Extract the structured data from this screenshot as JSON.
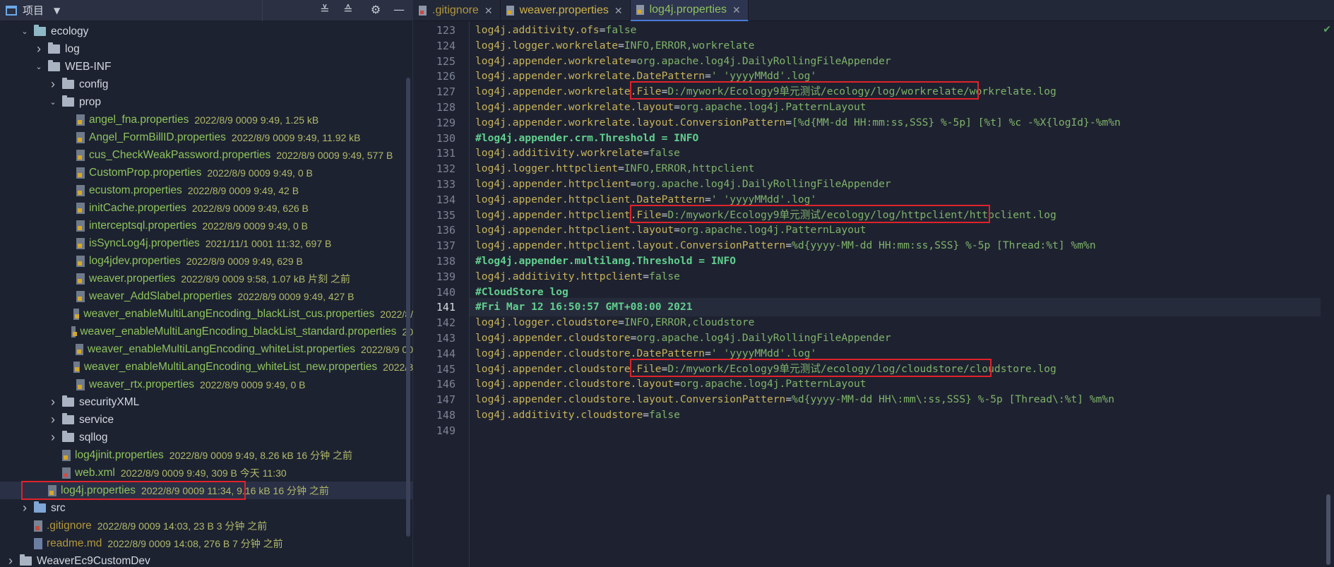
{
  "project_pane": {
    "title": "项目",
    "tree": [
      {
        "indent": 1,
        "arrow": "down",
        "icon": "folder-teal",
        "name": "ecology",
        "style": "normal",
        "meta": ""
      },
      {
        "indent": 2,
        "arrow": "right",
        "icon": "folder",
        "name": "log",
        "style": "normal",
        "meta": ""
      },
      {
        "indent": 2,
        "arrow": "down",
        "icon": "folder",
        "name": "WEB-INF",
        "style": "normal",
        "meta": ""
      },
      {
        "indent": 3,
        "arrow": "right",
        "icon": "folder",
        "name": "config",
        "style": "normal",
        "meta": ""
      },
      {
        "indent": 3,
        "arrow": "down",
        "icon": "folder",
        "name": "prop",
        "style": "normal",
        "meta": ""
      },
      {
        "indent": 4,
        "arrow": "",
        "icon": "properties",
        "name": "angel_fna.properties",
        "style": "mod",
        "meta": "2022/8/9 0009 9:49, 1.25 kB"
      },
      {
        "indent": 4,
        "arrow": "",
        "icon": "properties",
        "name": "Angel_FormBillID.properties",
        "style": "mod",
        "meta": "2022/8/9 0009 9:49, 11.92 kB"
      },
      {
        "indent": 4,
        "arrow": "",
        "icon": "properties",
        "name": "cus_CheckWeakPassword.properties",
        "style": "mod",
        "meta": "2022/8/9 0009 9:49, 577 B"
      },
      {
        "indent": 4,
        "arrow": "",
        "icon": "properties",
        "name": "CustomProp.properties",
        "style": "mod",
        "meta": "2022/8/9 0009 9:49, 0 B"
      },
      {
        "indent": 4,
        "arrow": "",
        "icon": "properties",
        "name": "ecustom.properties",
        "style": "mod",
        "meta": "2022/8/9 0009 9:49, 42 B"
      },
      {
        "indent": 4,
        "arrow": "",
        "icon": "properties",
        "name": "initCache.properties",
        "style": "mod",
        "meta": "2022/8/9 0009 9:49, 626 B"
      },
      {
        "indent": 4,
        "arrow": "",
        "icon": "properties",
        "name": "interceptsql.properties",
        "style": "mod",
        "meta": "2022/8/9 0009 9:49, 0 B"
      },
      {
        "indent": 4,
        "arrow": "",
        "icon": "properties",
        "name": "isSyncLog4j.properties",
        "style": "mod",
        "meta": "2021/11/1 0001 11:32, 697 B"
      },
      {
        "indent": 4,
        "arrow": "",
        "icon": "properties",
        "name": "log4jdev.properties",
        "style": "mod",
        "meta": "2022/8/9 0009 9:49, 629 B"
      },
      {
        "indent": 4,
        "arrow": "",
        "icon": "properties",
        "name": "weaver.properties",
        "style": "mod",
        "meta": "2022/8/9 0009 9:58, 1.07 kB 片刻 之前"
      },
      {
        "indent": 4,
        "arrow": "",
        "icon": "properties",
        "name": "weaver_AddSlabel.properties",
        "style": "mod",
        "meta": "2022/8/9 0009 9:49, 427 B"
      },
      {
        "indent": 4,
        "arrow": "",
        "icon": "properties",
        "name": "weaver_enableMultiLangEncoding_blackList_cus.properties",
        "style": "mod",
        "meta": "2022/8/"
      },
      {
        "indent": 4,
        "arrow": "",
        "icon": "properties",
        "name": "weaver_enableMultiLangEncoding_blackList_standard.properties",
        "style": "mod",
        "meta": "20"
      },
      {
        "indent": 4,
        "arrow": "",
        "icon": "properties",
        "name": "weaver_enableMultiLangEncoding_whiteList.properties",
        "style": "mod",
        "meta": "2022/8/9 00"
      },
      {
        "indent": 4,
        "arrow": "",
        "icon": "properties",
        "name": "weaver_enableMultiLangEncoding_whiteList_new.properties",
        "style": "mod",
        "meta": "2022/8"
      },
      {
        "indent": 4,
        "arrow": "",
        "icon": "properties",
        "name": "weaver_rtx.properties",
        "style": "mod",
        "meta": "2022/8/9 0009 9:49, 0 B"
      },
      {
        "indent": 3,
        "arrow": "right",
        "icon": "folder",
        "name": "securityXML",
        "style": "normal",
        "meta": ""
      },
      {
        "indent": 3,
        "arrow": "right",
        "icon": "folder",
        "name": "service",
        "style": "normal",
        "meta": ""
      },
      {
        "indent": 3,
        "arrow": "right",
        "icon": "folder",
        "name": "sqllog",
        "style": "normal",
        "meta": ""
      },
      {
        "indent": 3,
        "arrow": "",
        "icon": "properties",
        "name": "log4jinit.properties",
        "style": "mod",
        "meta": "2022/8/9 0009 9:49, 8.26 kB 16 分钟 之前"
      },
      {
        "indent": 3,
        "arrow": "",
        "icon": "xml",
        "name": "web.xml",
        "style": "mod",
        "meta": "2022/8/9 0009 9:49, 309 B 今天 11:30"
      },
      {
        "indent": 2,
        "arrow": "",
        "icon": "properties",
        "name": "log4j.properties",
        "style": "mod",
        "meta": "2022/8/9 0009 11:34, 9.16 kB 16 分钟 之前"
      },
      {
        "indent": 1,
        "arrow": "right",
        "icon": "folder-blue",
        "name": "src",
        "style": "normal",
        "meta": ""
      },
      {
        "indent": 1,
        "arrow": "",
        "icon": "git",
        "name": ".gitignore",
        "style": "untracked",
        "meta": "2022/8/9 0009 14:03, 23 B 3 分钟 之前"
      },
      {
        "indent": 1,
        "arrow": "",
        "icon": "md",
        "name": "readme.md",
        "style": "untracked",
        "meta": "2022/8/9 0009 14:08, 276 B 7 分钟 之前"
      },
      {
        "indent": 0,
        "arrow": "right",
        "icon": "folder",
        "name": "WeaverEc9CustomDev",
        "style": "normal",
        "meta": ""
      }
    ]
  },
  "tabs": [
    {
      "label": ".gitignore",
      "icon": "git",
      "style": "untracked",
      "active": false
    },
    {
      "label": "weaver.properties",
      "icon": "properties",
      "style": "mod",
      "active": false
    },
    {
      "label": "log4j.properties",
      "icon": "properties",
      "style": "mod",
      "active": true
    }
  ],
  "editor": {
    "current_line": 141,
    "lines": [
      {
        "n": 123,
        "k": "log4j.additivity.ofs",
        "v": "false"
      },
      {
        "n": 124,
        "k": "log4j.logger.workrelate",
        "v": "INFO,ERROR,workrelate"
      },
      {
        "n": 125,
        "k": "log4j.appender.workrelate",
        "v": "org.apache.log4j.DailyRollingFileAppender"
      },
      {
        "n": 126,
        "k": "log4j.appender.workrelate.DatePattern",
        "v": "'_'yyyyMMdd'.log'"
      },
      {
        "n": 127,
        "k": "log4j.appender.workrelate.File",
        "v": "D:/mywork/Ecology9单元测试/ecology/log/workrelate/workrelate.log"
      },
      {
        "n": 128,
        "k": "log4j.appender.workrelate.layout",
        "v": "org.apache.log4j.PatternLayout"
      },
      {
        "n": 129,
        "k": "log4j.appender.workrelate.layout.ConversionPattern",
        "v": "[%d{MM-dd HH:mm:ss,SSS} %-5p] [%t] %c -%X{logId}-%m%n"
      },
      {
        "n": 130,
        "comment": "#log4j.appender.crm.Threshold = INFO"
      },
      {
        "n": 131,
        "k": "log4j.additivity.workrelate",
        "v": "false"
      },
      {
        "n": 132,
        "k": "log4j.logger.httpclient",
        "v": "INFO,ERROR,httpclient"
      },
      {
        "n": 133,
        "k": "log4j.appender.httpclient",
        "v": "org.apache.log4j.DailyRollingFileAppender"
      },
      {
        "n": 134,
        "k": "log4j.appender.httpclient.DatePattern",
        "v": "'_'yyyyMMdd'.log'"
      },
      {
        "n": 135,
        "k": "log4j.appender.httpclient.File",
        "v": "D:/mywork/Ecology9单元测试/ecology/log/httpclient/httpclient.log"
      },
      {
        "n": 136,
        "k": "log4j.appender.httpclient.layout",
        "v": "org.apache.log4j.PatternLayout"
      },
      {
        "n": 137,
        "k": "log4j.appender.httpclient.layout.ConversionPattern",
        "v": "%d{yyyy-MM-dd HH:mm:ss,SSS} %-5p [Thread:%t] %m%n"
      },
      {
        "n": 138,
        "comment": "#log4j.appender.multilang.Threshold = INFO"
      },
      {
        "n": 139,
        "k": "log4j.additivity.httpclient",
        "v": "false"
      },
      {
        "n": 140,
        "comment": "#CloudStore log"
      },
      {
        "n": 141,
        "comment": "#Fri Mar 12 16:50:57 GMT+08:00 2021"
      },
      {
        "n": 142,
        "k": "log4j.logger.cloudstore",
        "v": "INFO,ERROR,cloudstore"
      },
      {
        "n": 143,
        "k": "log4j.appender.cloudstore",
        "v": "org.apache.log4j.DailyRollingFileAppender"
      },
      {
        "n": 144,
        "k": "log4j.appender.cloudstore.DatePattern",
        "v": "'_'yyyyMMdd'.log'"
      },
      {
        "n": 145,
        "k": "log4j.appender.cloudstore.File",
        "v": "D:/mywork/Ecology9单元测试/ecology/log/cloudstore/cloudstore.log"
      },
      {
        "n": 146,
        "k": "log4j.appender.cloudstore.layout",
        "v": "org.apache.log4j.PatternLayout"
      },
      {
        "n": 147,
        "k": "log4j.appender.cloudstore.layout.ConversionPattern",
        "v": "%d{yyyy-MM-dd HH\\:mm\\:ss,SSS} %-5p [Thread\\:%t] %m%n"
      },
      {
        "n": 148,
        "k": "log4j.additivity.cloudstore",
        "v": "false"
      },
      {
        "n": 149,
        "k": "",
        "v": ""
      }
    ]
  },
  "colors": {
    "highlight_box": "#e0222a",
    "modified_file": "#8ec35e",
    "untracked_file": "#b3973c",
    "comment": "#62d08f"
  }
}
